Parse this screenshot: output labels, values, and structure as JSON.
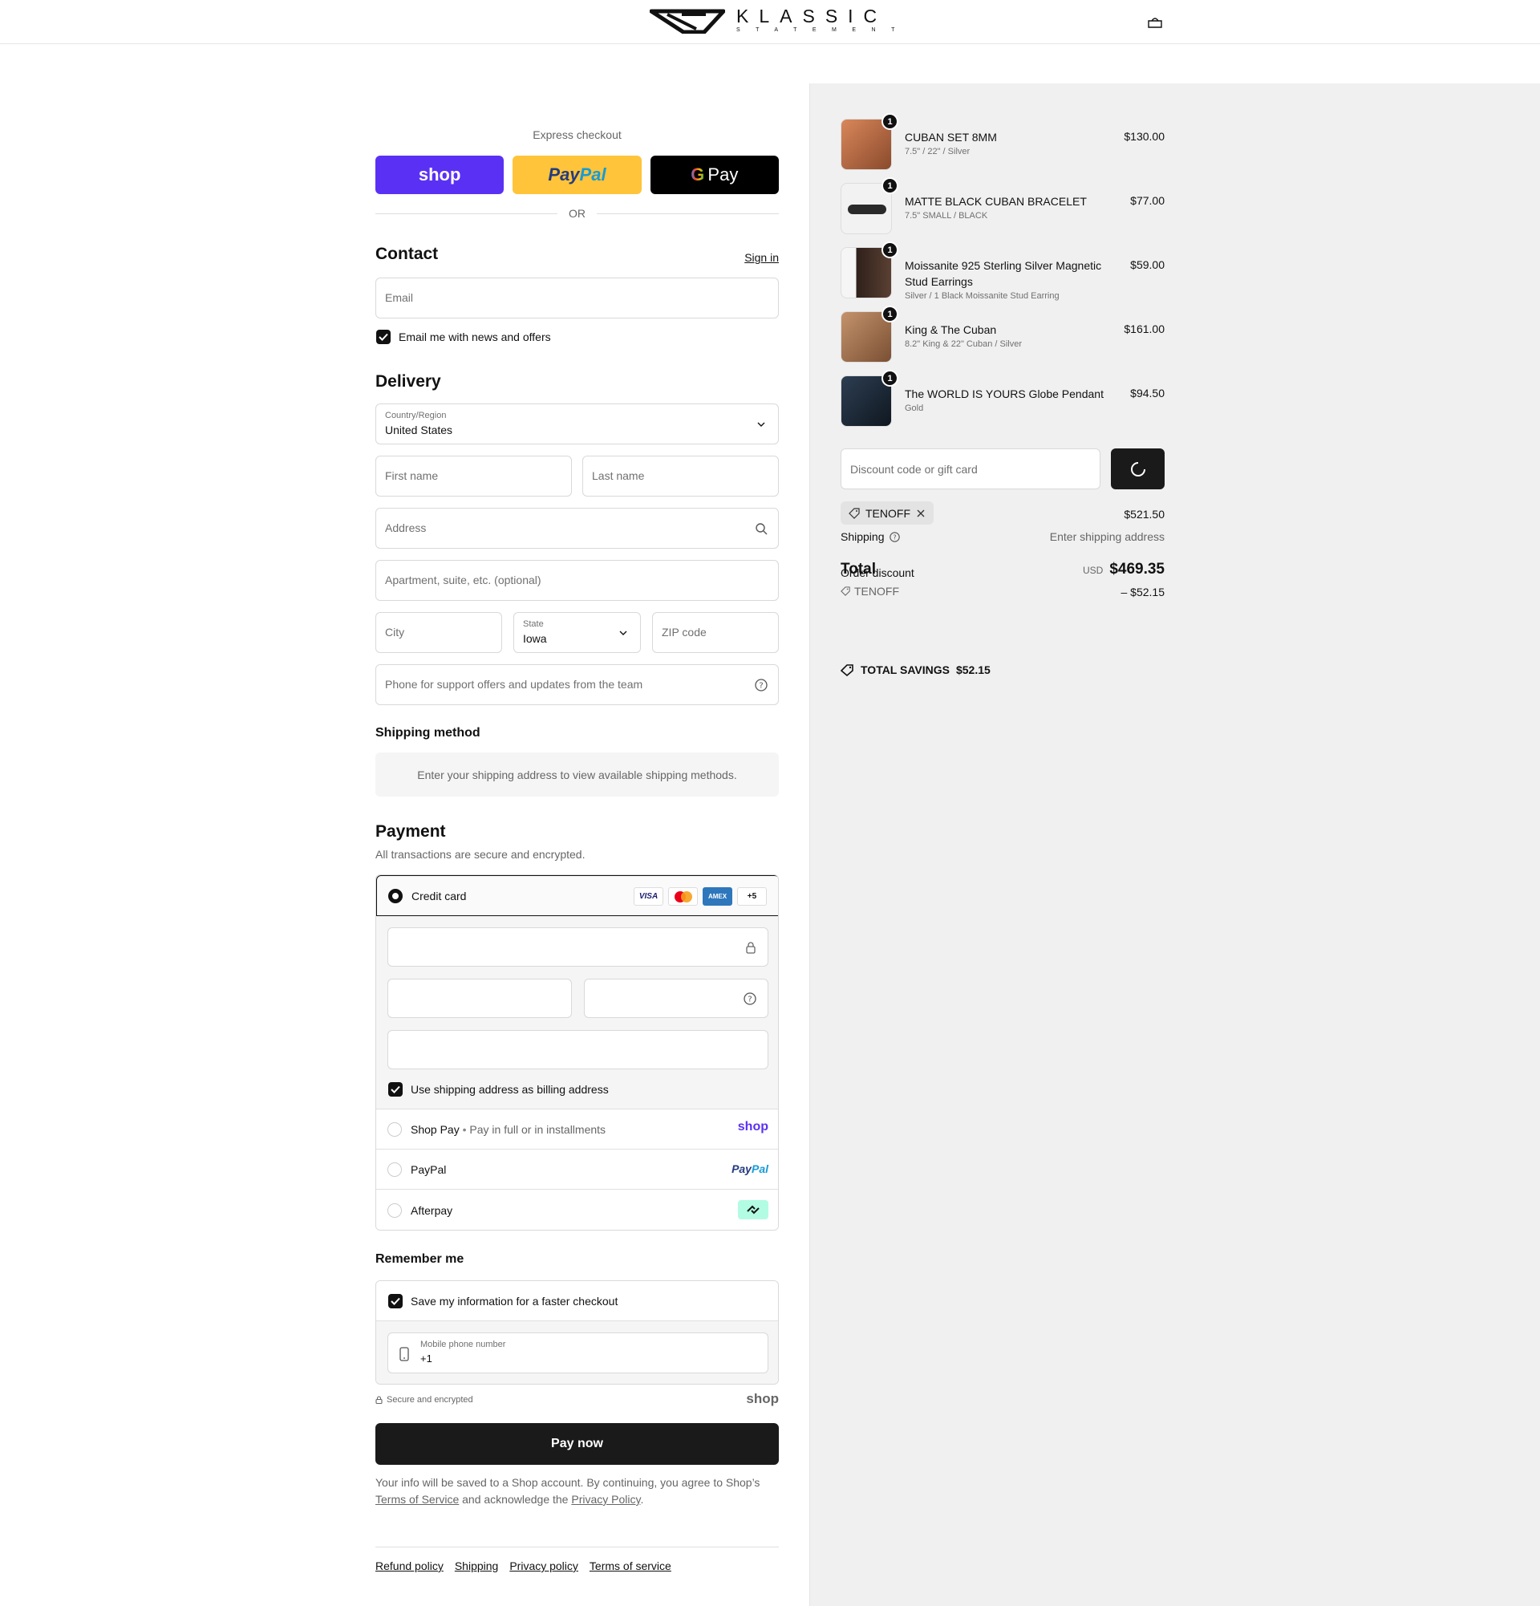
{
  "header": {
    "brand": "KLASSIC",
    "brand_sub": "STATEMENT",
    "cart_icon": "bag-icon"
  },
  "express": {
    "label": "Express checkout",
    "shop_label": "shop",
    "paypal_dark": "Pay",
    "paypal_light": "Pal",
    "gpay_label": "Pay",
    "or": "OR"
  },
  "contact": {
    "title": "Contact",
    "sign_in": "Sign in",
    "email_placeholder": "Email",
    "news_label": "Email me with news and offers"
  },
  "delivery": {
    "title": "Delivery",
    "country_label": "Country/Region",
    "country_value": "United States",
    "first_name": "First name",
    "last_name": "Last name",
    "address": "Address",
    "apartment": "Apartment, suite, etc. (optional)",
    "city": "City",
    "state_label": "State",
    "state_value": "Iowa",
    "zip": "ZIP code",
    "phone": "Phone for support offers and updates from the team"
  },
  "shipping_method": {
    "title": "Shipping method",
    "message": "Enter your shipping address to view available shipping methods."
  },
  "payment": {
    "title": "Payment",
    "subtitle": "All transactions are secure and encrypted.",
    "credit_card": "Credit card",
    "card_logos": [
      "VISA",
      "MC",
      "AMEX",
      "+5"
    ],
    "billing_same": "Use shipping address as billing address",
    "shop_pay": "Shop Pay",
    "shop_pay_sub": "Pay in full or in installments",
    "shop_pay_logo": "shop",
    "paypal": "PayPal",
    "paypal_logo_dark": "Pay",
    "paypal_logo_light": "Pal",
    "afterpay": "Afterpay"
  },
  "remember": {
    "title": "Remember me",
    "save_label": "Save my information for a faster checkout",
    "mobile_label": "Mobile phone number",
    "mobile_value": "+1",
    "secure": "Secure and encrypted",
    "shop_logo": "shop"
  },
  "pay_now": "Pay now",
  "legal": {
    "text1": "Your info will be saved to a Shop account. By continuing, you agree to Shop’s",
    "tos": "Terms of Service",
    "text2": "and acknowledge the",
    "privacy": "Privacy Policy",
    "text3": "."
  },
  "footer_links": [
    "Refund policy",
    "Shipping",
    "Privacy policy",
    "Terms of service"
  ],
  "order": {
    "items": [
      {
        "name": "CUBAN SET 8MM",
        "variant": "7.5\" / 22\" / Silver",
        "price": "$130.00",
        "qty": "1",
        "thumb": "#c8744a"
      },
      {
        "name": "MATTE BLACK CUBAN BRACELET",
        "variant": "7.5\" SMALL / BLACK",
        "price": "$77.00",
        "qty": "1",
        "thumb": "#e8e8e8"
      },
      {
        "name": "Moissanite 925 Sterling Silver Magnetic Stud Earrings",
        "variant": "Silver / 1 Black Moissanite Stud Earring",
        "price": "$59.00",
        "qty": "1",
        "thumb": "#3a2a22"
      },
      {
        "name": "King & The Cuban",
        "variant": "8.2\" King & 22\" Cuban / Silver",
        "price": "$161.00",
        "qty": "1",
        "thumb": "#b9855f"
      },
      {
        "name": "The WORLD IS YOURS Globe Pendant",
        "variant": "Gold",
        "price": "$94.50",
        "qty": "1",
        "thumb": "#1c2a3a"
      }
    ],
    "discount_placeholder": "Discount code or gift card",
    "code": "TENOFF",
    "subtotal": "$521.50",
    "shipping_label": "Shipping",
    "shipping_value": "Enter shipping address",
    "total_label": "Total",
    "currency": "USD",
    "total": "$469.35",
    "order_discount_label": "Order discount",
    "discount_amount": "– $52.15",
    "savings_label": "TOTAL SAVINGS",
    "savings_value": "$52.15"
  }
}
